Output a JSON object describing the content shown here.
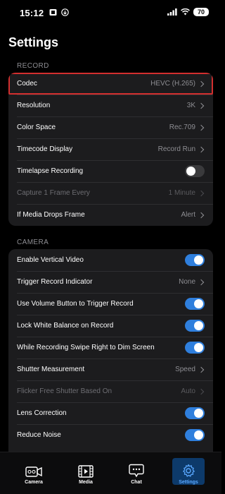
{
  "status": {
    "time": "15:12",
    "battery": "70"
  },
  "title": "Settings",
  "record": {
    "header": "RECORD",
    "rows": [
      {
        "label": "Codec",
        "value": "HEVC (H.265)"
      },
      {
        "label": "Resolution",
        "value": "3K"
      },
      {
        "label": "Color Space",
        "value": "Rec.709"
      },
      {
        "label": "Timecode Display",
        "value": "Record Run"
      },
      {
        "label": "Timelapse Recording",
        "toggle": "off"
      },
      {
        "label": "Capture 1 Frame Every",
        "value": "1 Minute"
      },
      {
        "label": "If Media Drops Frame",
        "value": "Alert"
      }
    ]
  },
  "camera": {
    "header": "CAMERA",
    "rows": [
      {
        "label": "Enable Vertical Video",
        "toggle": "on"
      },
      {
        "label": "Trigger Record Indicator",
        "value": "None"
      },
      {
        "label": "Use Volume Button to Trigger Record",
        "toggle": "on"
      },
      {
        "label": "Lock White Balance on Record",
        "toggle": "on"
      },
      {
        "label": "While Recording Swipe Right to Dim Screen",
        "toggle": "on"
      },
      {
        "label": "Shutter Measurement",
        "value": "Speed"
      },
      {
        "label": "Flicker Free Shutter Based On",
        "value": "Auto"
      },
      {
        "label": "Lens Correction",
        "toggle": "on"
      },
      {
        "label": "Reduce Noise",
        "toggle": "on"
      }
    ]
  },
  "tabs": [
    {
      "label": "Camera",
      "icon": "camera-icon"
    },
    {
      "label": "Media",
      "icon": "film-icon"
    },
    {
      "label": "Chat",
      "icon": "chat-icon"
    },
    {
      "label": "Settings",
      "icon": "gear-icon"
    }
  ],
  "colors": {
    "accent": "#2f7fdd",
    "highlight": "#d32f2f",
    "active_tab_bg": "#0d3a6a"
  }
}
